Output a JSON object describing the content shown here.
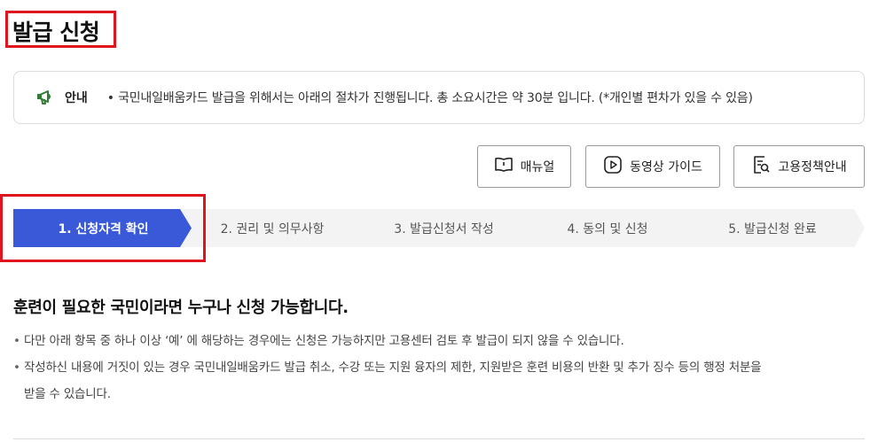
{
  "page": {
    "title": "발급 신청"
  },
  "notice": {
    "icon": "megaphone-icon",
    "label": "안내",
    "text": "• 국민내일배움카드 발급을 위해서는 아래의 절차가 진행됩니다. 총 소요시간은 약 30분 입니다. (*개인별 편차가 있을 수 있음)"
  },
  "buttons": {
    "manual": {
      "label": "매뉴얼",
      "icon": "book-icon"
    },
    "video": {
      "label": "동영상 가이드",
      "icon": "play-icon"
    },
    "policy": {
      "label": "고용정책안내",
      "icon": "document-search-icon"
    }
  },
  "steps": [
    {
      "label": "1. 신청자격 확인",
      "active": true
    },
    {
      "label": "2. 권리 및 의무사항",
      "active": false
    },
    {
      "label": "3. 발급신청서 작성",
      "active": false
    },
    {
      "label": "4. 동의 및 신청",
      "active": false
    },
    {
      "label": "5. 발급신청 완료",
      "active": false
    }
  ],
  "content": {
    "headline": "훈련이 필요한 국민이라면 누구나 신청 가능합니다.",
    "bullets": [
      "다만 아래 항목 중 하나 이상 ‘예’ 에 해당하는 경우에는 신청은 가능하지만 고용센터 검토 후 발급이 되지 않을 수 있습니다.",
      "작성하신 내용에 거짓이 있는 경우 국민내일배움카드 발급 취소, 수강 또는 지원 융자의 제한, 지원받은 훈련 비용의 반환 및 추가 징수 등의 행정 처분을",
      "받을 수 있습니다."
    ]
  },
  "colors": {
    "accent": "#3a59d9",
    "highlight": "#e0141e",
    "step_inactive": "#f3f3f3"
  }
}
